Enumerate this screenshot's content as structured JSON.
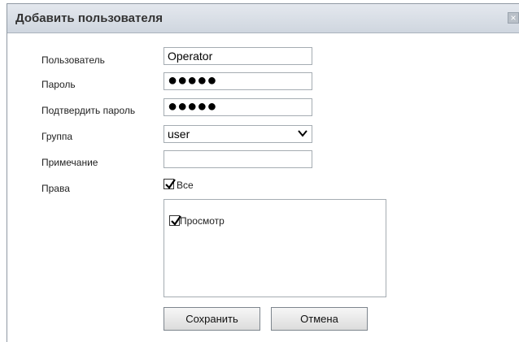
{
  "dialog": {
    "title": "Добавить пользователя",
    "close_glyph": "×"
  },
  "form": {
    "user_label": "Пользователь",
    "user_value": "Operator",
    "password_label": "Пароль",
    "password_mask": "●●●●●",
    "confirm_label": "Подтвердить пароль",
    "confirm_mask": "●●●●●",
    "group_label": "Группа",
    "group_value": "user",
    "note_label": "Примечание",
    "note_value": "",
    "rights_label": "Права",
    "all_label": "Все",
    "all_checked": true,
    "permissions": [
      {
        "label": "Просмотр",
        "checked": true
      }
    ]
  },
  "buttons": {
    "save_label": "Сохранить",
    "cancel_label": "Отмена"
  },
  "icons": {
    "close": "close-icon",
    "dropdown": "chevron-down-icon",
    "check": "checkmark-icon"
  },
  "colors": {
    "titlebar": "#d6dce4",
    "border": "#a5acb2",
    "button": "#e8e8e8"
  }
}
